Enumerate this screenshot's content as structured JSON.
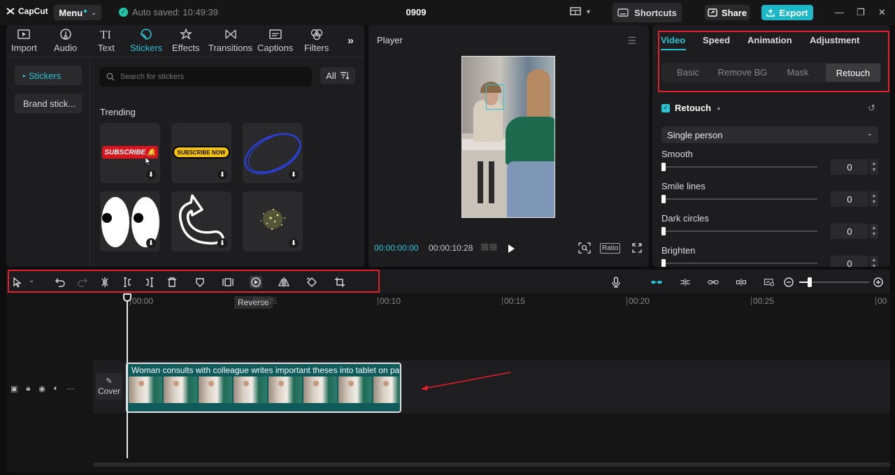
{
  "app": {
    "logo_text": "CapCut",
    "menu_label": "Menu",
    "autosave_text": "Auto saved: 10:49:39",
    "project_title": "0909",
    "shortcuts_label": "Shortcuts",
    "share_label": "Share",
    "export_label": "Export",
    "accent_color": "#2ac3d6"
  },
  "media": {
    "tabs": [
      {
        "label": "Import",
        "icon": "import-icon"
      },
      {
        "label": "Audio",
        "icon": "audio-icon"
      },
      {
        "label": "Text",
        "icon": "text-icon"
      },
      {
        "label": "Stickers",
        "icon": "stickers-icon",
        "active": true
      },
      {
        "label": "Effects",
        "icon": "effects-icon"
      },
      {
        "label": "Transitions",
        "icon": "transitions-icon"
      },
      {
        "label": "Captions",
        "icon": "captions-icon"
      },
      {
        "label": "Filters",
        "icon": "filters-icon"
      }
    ],
    "categories": [
      {
        "label": "Stickers",
        "active": true
      },
      {
        "label": "Brand stick..."
      }
    ],
    "search_placeholder": "Search for stickers",
    "filter_label": "All",
    "section_title": "Trending",
    "stickers": [
      {
        "name": "subscribe-bell-sticker",
        "text": "SUBSCRIBE"
      },
      {
        "name": "subscribe-now-sticker",
        "text": "SUBSCRIBE NOW"
      },
      {
        "name": "blue-circle-sticker"
      },
      {
        "name": "cartoon-eyes-sticker"
      },
      {
        "name": "arrow-outline-sticker"
      },
      {
        "name": "sparkle-particles-sticker"
      }
    ]
  },
  "player": {
    "title": "Player",
    "current_time": "00:00:00:00",
    "total_time": "00:00:10:28",
    "ratio_label": "Ratio"
  },
  "props": {
    "tabs": [
      "Video",
      "Speed",
      "Animation",
      "Adjustment"
    ],
    "active_tab": "Video",
    "subtabs": [
      "Basic",
      "Remove BG",
      "Mask",
      "Retouch"
    ],
    "active_subtab": "Retouch",
    "section_title": "Retouch",
    "mode_select": "Single person",
    "sliders": [
      {
        "label": "Smooth",
        "value": "0"
      },
      {
        "label": "Smile lines",
        "value": "0"
      },
      {
        "label": "Dark circles",
        "value": "0"
      },
      {
        "label": "Brighten",
        "value": "0"
      }
    ]
  },
  "timeline": {
    "tooltip": "Reverse",
    "ruler_labels": [
      "00:00",
      "00:05",
      "00:10",
      "00:15",
      "00:20",
      "00:25",
      "00"
    ],
    "cover_label": "Cover",
    "clip_title": "Woman consults with colleague writes important theses into tablet on pa"
  }
}
